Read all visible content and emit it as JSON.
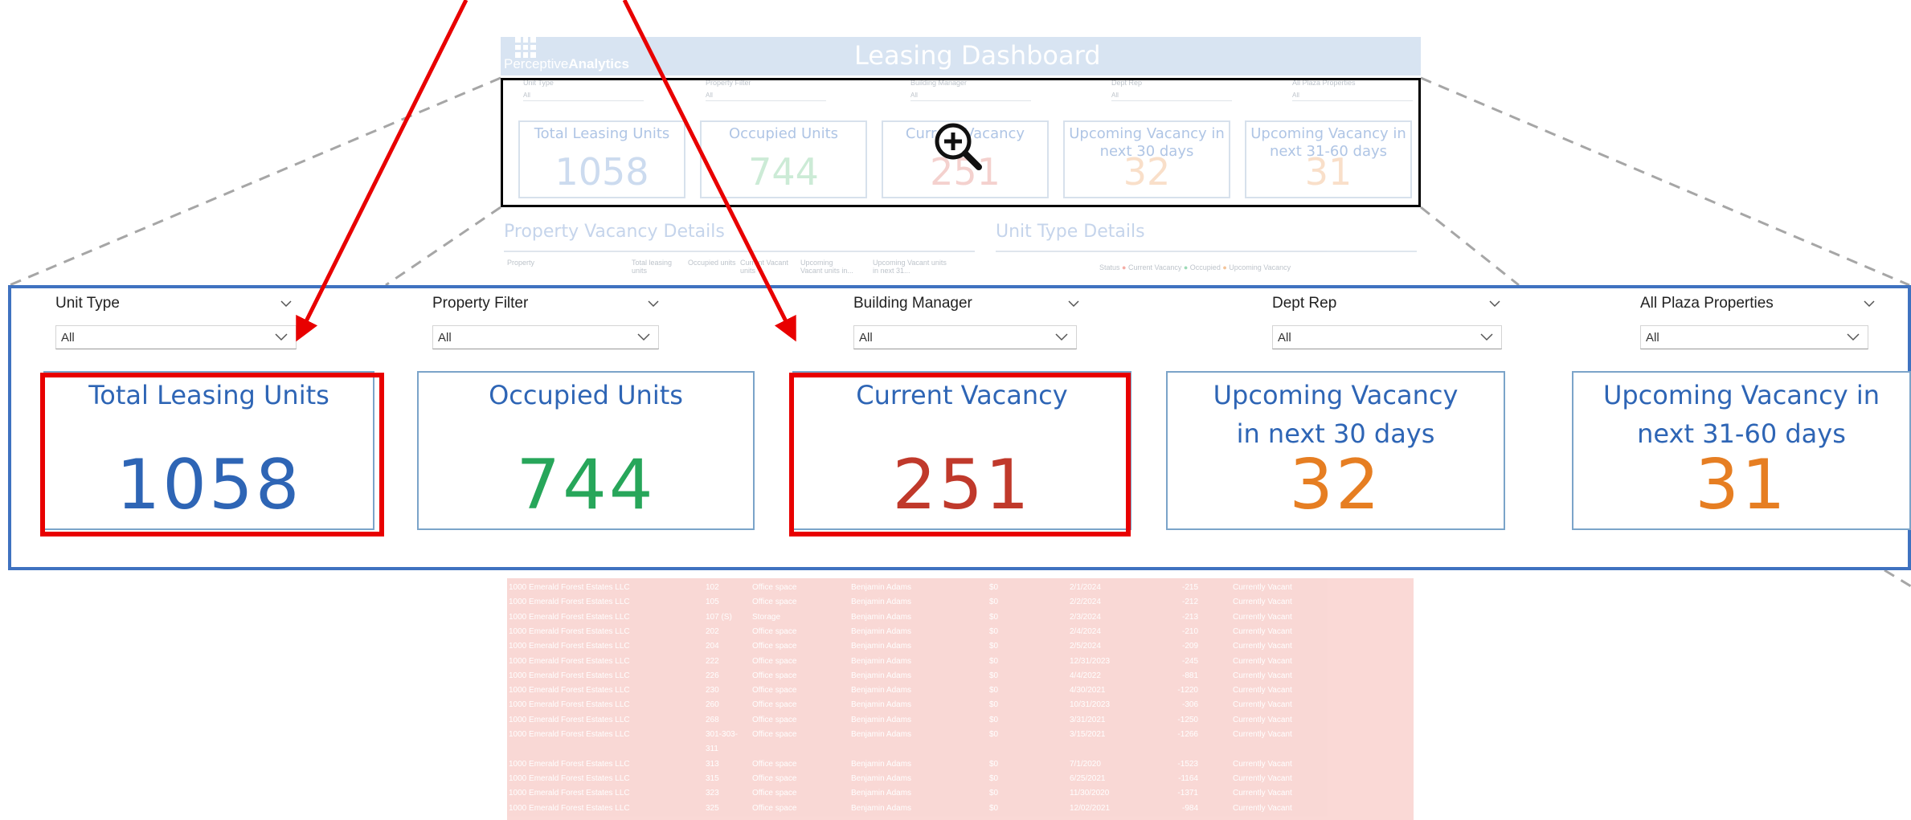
{
  "background_dashboard": {
    "logo_text_light": "Perceptive",
    "logo_text_bold": "Analytics",
    "title": "Leasing Dashboard",
    "slicers": [
      {
        "label": "Unit Type",
        "value": "All"
      },
      {
        "label": "Property Filter",
        "value": "All"
      },
      {
        "label": "Building Manager",
        "value": "All"
      },
      {
        "label": "Dept Rep",
        "value": "All"
      },
      {
        "label": "All Plaza Properties",
        "value": "All"
      }
    ],
    "cards": [
      {
        "title": "Total Leasing Units",
        "value": "1058",
        "color": "#8fb0dc"
      },
      {
        "title": "Occupied Units",
        "value": "744",
        "color": "#8fd3a5"
      },
      {
        "title": "Current Vacancy",
        "value": "251",
        "color": "#e79a94"
      },
      {
        "title": "Upcoming Vacancy in next 30 days",
        "value": "32",
        "color": "#f2b98a"
      },
      {
        "title": "Upcoming Vacancy in next 31-60 days",
        "value": "31",
        "color": "#f2b98a"
      }
    ],
    "section_property": "Property Vacancy Details",
    "section_unit": "Unit Type Details",
    "property_table_headers": [
      "Property",
      "Total leasing units",
      "Occupied units",
      "Current Vacant units",
      "Upcoming Vacant units in...",
      "Upcoming Vacant units in next 31..."
    ],
    "unit_legend": {
      "label": "Status",
      "items": [
        "Current Vacancy",
        "Occupied",
        "Upcoming Vacancy"
      ]
    },
    "table_rows": [
      {
        "owner": "1000 Emerald Forest Estates LLC",
        "unit": "102",
        "type": "Office space",
        "manager": "Benjamin Adams",
        "rent": "$0",
        "date": "2/1/2024",
        "days": "-215",
        "status": "Currently Vacant"
      },
      {
        "owner": "1000 Emerald Forest Estates LLC",
        "unit": "105",
        "type": "Office space",
        "manager": "Benjamin Adams",
        "rent": "$0",
        "date": "2/2/2024",
        "days": "-212",
        "status": "Currently Vacant"
      },
      {
        "owner": "1000 Emerald Forest Estates LLC",
        "unit": "107 (S)",
        "type": "Storage",
        "manager": "Benjamin Adams",
        "rent": "$0",
        "date": "2/3/2024",
        "days": "-213",
        "status": "Currently Vacant"
      },
      {
        "owner": "1000 Emerald Forest Estates LLC",
        "unit": "202",
        "type": "Office space",
        "manager": "Benjamin Adams",
        "rent": "$0",
        "date": "2/4/2024",
        "days": "-210",
        "status": "Currently Vacant"
      },
      {
        "owner": "1000 Emerald Forest Estates LLC",
        "unit": "204",
        "type": "Office space",
        "manager": "Benjamin Adams",
        "rent": "$0",
        "date": "2/5/2024",
        "days": "-209",
        "status": "Currently Vacant"
      },
      {
        "owner": "1000 Emerald Forest Estates LLC",
        "unit": "222",
        "type": "Office space",
        "manager": "Benjamin Adams",
        "rent": "$0",
        "date": "12/31/2023",
        "days": "-245",
        "status": "Currently Vacant"
      },
      {
        "owner": "1000 Emerald Forest Estates LLC",
        "unit": "226",
        "type": "Office space",
        "manager": "Benjamin Adams",
        "rent": "$0",
        "date": "4/4/2022",
        "days": "-881",
        "status": "Currently Vacant"
      },
      {
        "owner": "1000 Emerald Forest Estates LLC",
        "unit": "230",
        "type": "Office space",
        "manager": "Benjamin Adams",
        "rent": "$0",
        "date": "4/30/2021",
        "days": "-1220",
        "status": "Currently Vacant"
      },
      {
        "owner": "1000 Emerald Forest Estates LLC",
        "unit": "260",
        "type": "Office space",
        "manager": "Benjamin Adams",
        "rent": "$0",
        "date": "10/31/2023",
        "days": "-306",
        "status": "Currently Vacant"
      },
      {
        "owner": "1000 Emerald Forest Estates LLC",
        "unit": "268",
        "type": "Office space",
        "manager": "Benjamin Adams",
        "rent": "$0",
        "date": "3/31/2021",
        "days": "-1250",
        "status": "Currently Vacant"
      },
      {
        "owner": "1000 Emerald Forest Estates LLC",
        "unit": "301-303-",
        "type": "Office space",
        "manager": "Benjamin Adams",
        "rent": "$0",
        "date": "3/15/2021",
        "days": "-1266",
        "status": "Currently Vacant"
      },
      {
        "owner": "",
        "unit": "311",
        "type": "",
        "manager": "",
        "rent": "",
        "date": "",
        "days": "",
        "status": ""
      },
      {
        "owner": "1000 Emerald Forest Estates LLC",
        "unit": "313",
        "type": "Office space",
        "manager": "Benjamin Adams",
        "rent": "$0",
        "date": "7/1/2020",
        "days": "-1523",
        "status": "Currently Vacant"
      },
      {
        "owner": "1000 Emerald Forest Estates LLC",
        "unit": "315",
        "type": "Office space",
        "manager": "Benjamin Adams",
        "rent": "$0",
        "date": "6/25/2021",
        "days": "-1164",
        "status": "Currently Vacant"
      },
      {
        "owner": "1000 Emerald Forest Estates LLC",
        "unit": "323",
        "type": "Office space",
        "manager": "Benjamin Adams",
        "rent": "$0",
        "date": "11/30/2020",
        "days": "-1371",
        "status": "Currently Vacant"
      },
      {
        "owner": "1000 Emerald Forest Estates LLC",
        "unit": "325",
        "type": "Office space",
        "manager": "Benjamin Adams",
        "rent": "$0",
        "date": "12/02/2021",
        "days": "-984",
        "status": "Currently Vacant"
      }
    ]
  },
  "zoom": {
    "slicers": [
      {
        "label": "Unit Type",
        "value": "All"
      },
      {
        "label": "Property Filter",
        "value": "All"
      },
      {
        "label": "Building Manager",
        "value": "All"
      },
      {
        "label": "Dept Rep",
        "value": "All"
      },
      {
        "label": "All Plaza Properties",
        "value": "All"
      }
    ],
    "cards": [
      {
        "title": "Total Leasing Units",
        "value": "1058",
        "color": "#2e65b5"
      },
      {
        "title": "Occupied Units",
        "value": "744",
        "color": "#27a65a"
      },
      {
        "title": "Current Vacancy",
        "value": "251",
        "color": "#c0392b"
      },
      {
        "title": "Upcoming Vacancy in next 30 days",
        "value": "32",
        "color": "#e67e22"
      },
      {
        "title": "Upcoming Vacancy in next 31-60 days",
        "value": "31",
        "color": "#e67e22"
      }
    ]
  },
  "colors": {
    "zoom_border": "#3f72c0",
    "highlight": "#e80000",
    "card_border": "#7ba4c9"
  },
  "icons": [
    "zoom-in-icon",
    "chevron-down-icon"
  ]
}
